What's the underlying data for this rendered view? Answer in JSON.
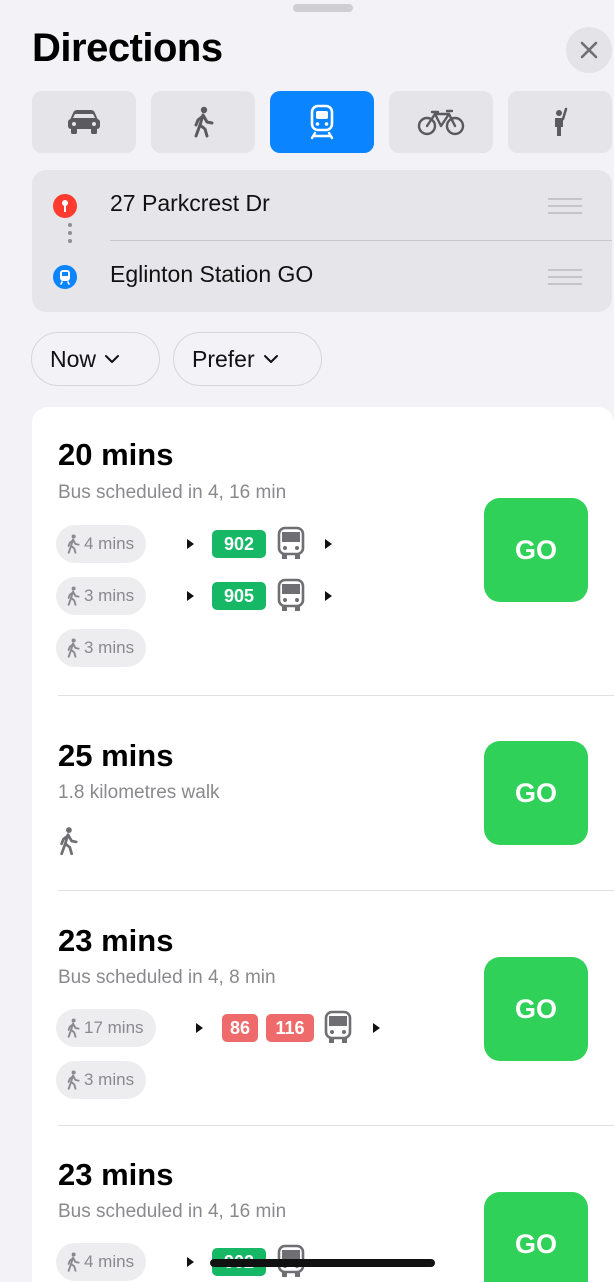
{
  "header": {
    "title": "Directions",
    "close_icon": "close-icon"
  },
  "modes": [
    {
      "name": "drive",
      "icon": "car-icon",
      "active": false
    },
    {
      "name": "walk",
      "icon": "walk-icon",
      "active": false
    },
    {
      "name": "transit",
      "icon": "train-icon",
      "active": true
    },
    {
      "name": "cycle",
      "icon": "bicycle-icon",
      "active": false
    },
    {
      "name": "ride",
      "icon": "person-hail-icon",
      "active": false
    }
  ],
  "route": {
    "origin": "27 Parkcrest Dr",
    "destination": "Eglinton Station GO"
  },
  "filters": {
    "time": "Now",
    "prefer": "Prefer"
  },
  "colors": {
    "accent": "#0a84ff",
    "go": "#30d158",
    "line_green": "#16b866",
    "line_red": "#ef6b6b",
    "pin_red": "#ff3b30"
  },
  "results": [
    {
      "duration": "20 mins",
      "subtitle": "Bus scheduled in 4, 16 min",
      "go_label": "GO",
      "legs": [
        {
          "walk": "4 mins",
          "line": "902"
        },
        {
          "walk": "3 mins",
          "line": "905"
        },
        {
          "walk": "3 mins"
        }
      ]
    },
    {
      "duration": "25 mins",
      "subtitle": "1.8 kilometres walk",
      "go_label": "GO"
    },
    {
      "duration": "23 mins",
      "subtitle": "Bus scheduled in 4, 8 min",
      "go_label": "GO",
      "legs": [
        {
          "walk": "17 mins",
          "lines": [
            "86",
            "116"
          ]
        },
        {
          "walk": "3 mins"
        }
      ]
    },
    {
      "duration": "23 mins",
      "subtitle": "Bus scheduled in 4, 16 min",
      "go_label": "GO",
      "legs": [
        {
          "walk": "4 mins",
          "line": "902"
        }
      ]
    }
  ]
}
